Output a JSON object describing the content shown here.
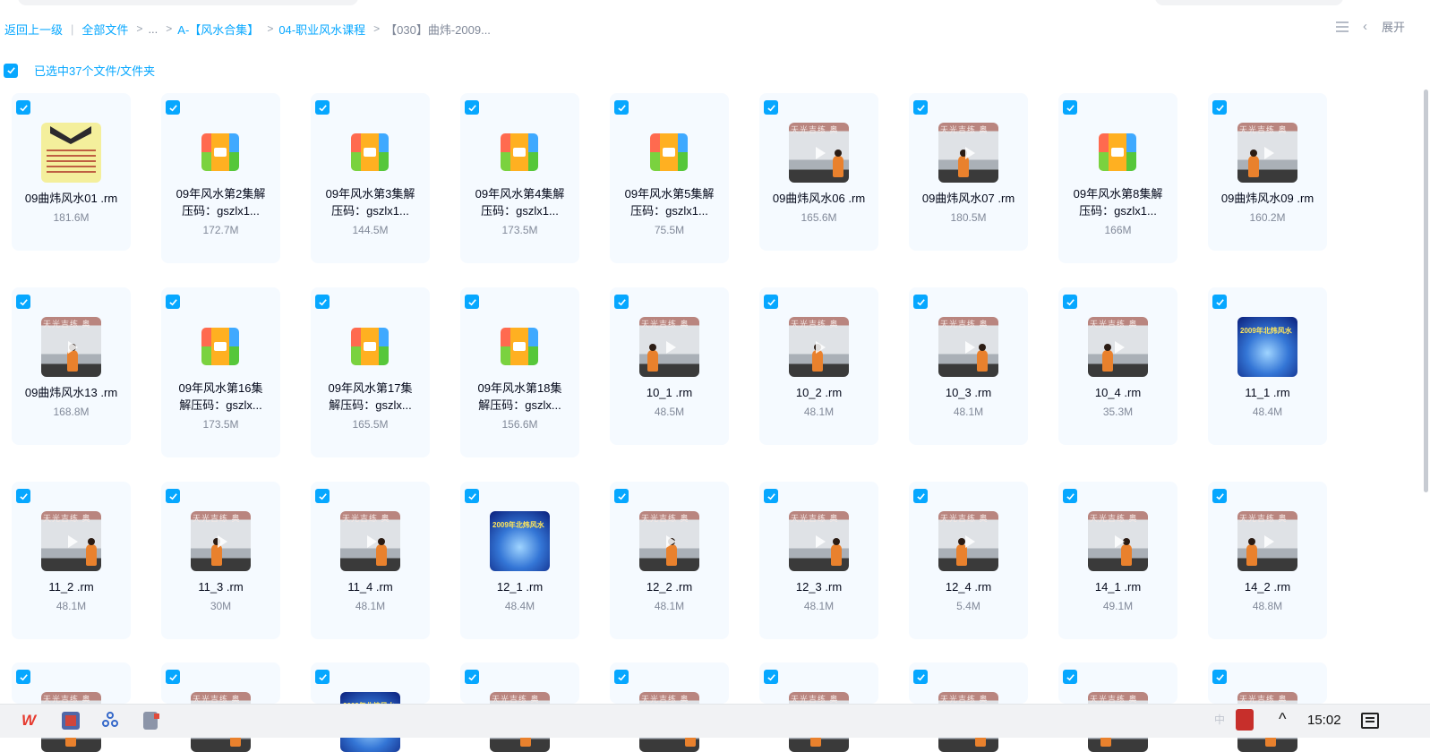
{
  "breadcrumb": {
    "back": "返回上一级",
    "divider": "|",
    "all_files": "全部文件",
    "sep": ">",
    "ellipsis": "...",
    "level1": "A-【风水合集】",
    "level2": "04-职业风水课程",
    "current": "【030】曲炜-2009..."
  },
  "toolbar": {
    "expand_label": "展开",
    "chevron": "‹"
  },
  "selection": {
    "label": "已选中37个文件/文件夹"
  },
  "files": [
    {
      "name": "09曲炜风水01 .rm",
      "size": "181.6M",
      "thumb": "yellow"
    },
    {
      "name": "09年风水第2集解压码：gszlx1...",
      "size": "172.7M",
      "thumb": "zip"
    },
    {
      "name": "09年风水第3集解压码：gszlx1...",
      "size": "144.5M",
      "thumb": "zip"
    },
    {
      "name": "09年风水第4集解压码：gszlx1...",
      "size": "173.5M",
      "thumb": "zip"
    },
    {
      "name": "09年风水第5集解压码：gszlx1...",
      "size": "75.5M",
      "thumb": "zip"
    },
    {
      "name": "09曲炜风水06 .rm",
      "size": "165.6M",
      "thumb": "video"
    },
    {
      "name": "09曲炜风水07 .rm",
      "size": "180.5M",
      "thumb": "video"
    },
    {
      "name": "09年风水第8集解压码：gszlx1...",
      "size": "166M",
      "thumb": "zip"
    },
    {
      "name": "09曲炜风水09 .rm",
      "size": "160.2M",
      "thumb": "video"
    },
    {
      "name": "09曲炜风水13 .rm",
      "size": "168.8M",
      "thumb": "video"
    },
    {
      "name": "09年风水第16集解压码：gszlx...",
      "size": "173.5M",
      "thumb": "zip"
    },
    {
      "name": "09年风水第17集解压码：gszlx...",
      "size": "165.5M",
      "thumb": "zip"
    },
    {
      "name": "09年风水第18集解压码：gszlx...",
      "size": "156.6M",
      "thumb": "zip"
    },
    {
      "name": "10_1 .rm",
      "size": "48.5M",
      "thumb": "video"
    },
    {
      "name": "10_2 .rm",
      "size": "48.1M",
      "thumb": "video"
    },
    {
      "name": "10_3 .rm",
      "size": "48.1M",
      "thumb": "video"
    },
    {
      "name": "10_4 .rm",
      "size": "35.3M",
      "thumb": "video"
    },
    {
      "name": "11_1 .rm",
      "size": "48.4M",
      "thumb": "blue"
    },
    {
      "name": "11_2 .rm",
      "size": "48.1M",
      "thumb": "video"
    },
    {
      "name": "11_3 .rm",
      "size": "30M",
      "thumb": "video"
    },
    {
      "name": "11_4 .rm",
      "size": "48.1M",
      "thumb": "video"
    },
    {
      "name": "12_1 .rm",
      "size": "48.4M",
      "thumb": "blue"
    },
    {
      "name": "12_2 .rm",
      "size": "48.1M",
      "thumb": "video"
    },
    {
      "name": "12_3 .rm",
      "size": "48.1M",
      "thumb": "video"
    },
    {
      "name": "12_4 .rm",
      "size": "5.4M",
      "thumb": "video"
    },
    {
      "name": "14_1 .rm",
      "size": "49.1M",
      "thumb": "video"
    },
    {
      "name": "14_2 .rm",
      "size": "48.8M",
      "thumb": "video"
    },
    {
      "name": "",
      "size": "",
      "thumb": "video"
    },
    {
      "name": "",
      "size": "",
      "thumb": "video"
    },
    {
      "name": "",
      "size": "",
      "thumb": "blue"
    },
    {
      "name": "",
      "size": "",
      "thumb": "video"
    },
    {
      "name": "",
      "size": "",
      "thumb": "video"
    },
    {
      "name": "",
      "size": "",
      "thumb": "video"
    },
    {
      "name": "",
      "size": "",
      "thumb": "video"
    },
    {
      "name": "",
      "size": "",
      "thumb": "video"
    },
    {
      "name": "",
      "size": "",
      "thumb": "video"
    }
  ],
  "thumb_text": {
    "video_banner": "天光吉练 奥",
    "blue_title": "2009年北炜风水"
  },
  "taskbar": {
    "app_wps": "W",
    "ime": "中",
    "up": "^",
    "time": "15:02"
  },
  "colors": {
    "accent": "#06a7ff",
    "card_bg": "#f5faff",
    "muted": "#818999"
  }
}
